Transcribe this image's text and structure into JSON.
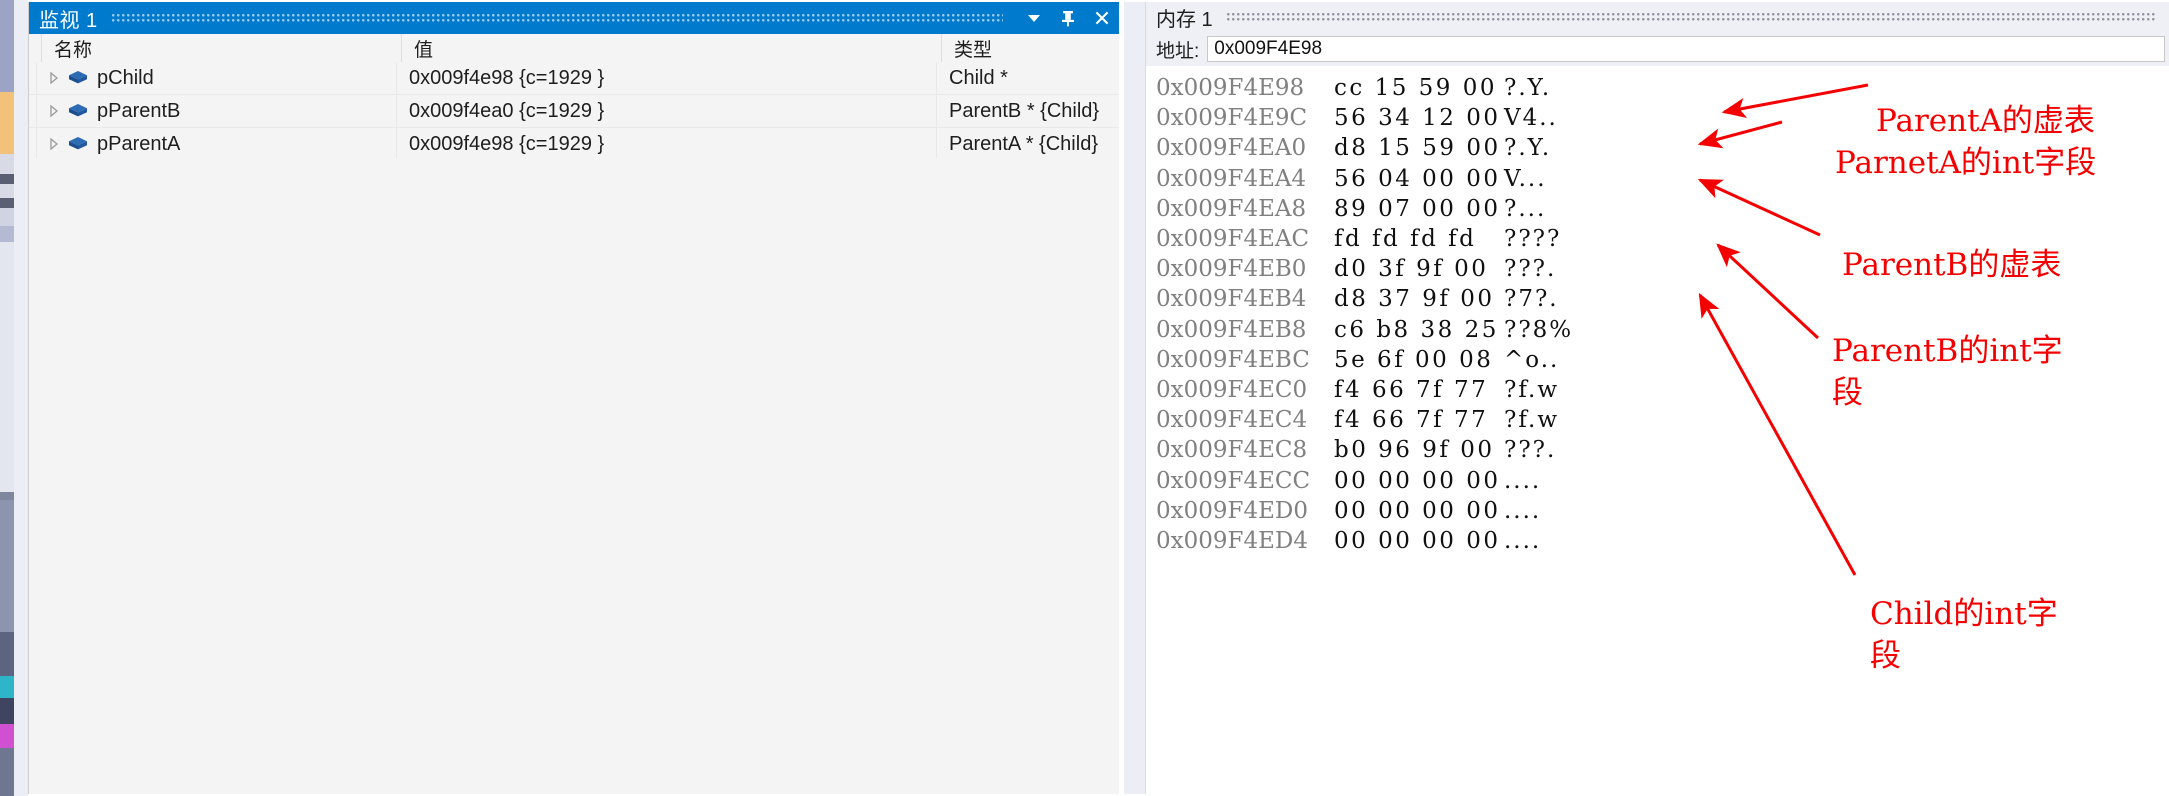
{
  "watch": {
    "title": "监视 1",
    "titlebar_buttons": [
      {
        "name": "dropdown-icon",
        "glyph": "chevron-down"
      },
      {
        "name": "pin-icon",
        "glyph": "pin"
      },
      {
        "name": "close-icon",
        "glyph": "close"
      }
    ],
    "columns": [
      "名称",
      "值",
      "类型"
    ],
    "rows": [
      {
        "name": "pChild",
        "value": "0x009f4e98 {c=1929 }",
        "type": "Child *"
      },
      {
        "name": "pParentB",
        "value": "0x009f4ea0 {c=1929 }",
        "type": "ParentB * {Child}"
      },
      {
        "name": "pParentA",
        "value": "0x009f4e98 {c=1929 }",
        "type": "ParentA * {Child}"
      }
    ]
  },
  "memory": {
    "title": "内存 1",
    "address_label": "地址:",
    "address_value": "0x009F4E98",
    "rows": [
      {
        "address": "0x009F4E98",
        "bytes": "cc 15 59 00",
        "ascii": "?.Y."
      },
      {
        "address": "0x009F4E9C",
        "bytes": "56 34 12 00",
        "ascii": "V4.."
      },
      {
        "address": "0x009F4EA0",
        "bytes": "d8 15 59 00",
        "ascii": "?.Y."
      },
      {
        "address": "0x009F4EA4",
        "bytes": "56 04 00 00",
        "ascii": "V..."
      },
      {
        "address": "0x009F4EA8",
        "bytes": "89 07 00 00",
        "ascii": "?..."
      },
      {
        "address": "0x009F4EAC",
        "bytes": "fd fd fd fd",
        "ascii": "????"
      },
      {
        "address": "0x009F4EB0",
        "bytes": "d0 3f 9f 00",
        "ascii": "???."
      },
      {
        "address": "0x009F4EB4",
        "bytes": "d8 37 9f 00",
        "ascii": "?7?."
      },
      {
        "address": "0x009F4EB8",
        "bytes": "c6 b8 38 25",
        "ascii": "??8%"
      },
      {
        "address": "0x009F4EBC",
        "bytes": "5e 6f 00 08",
        "ascii": "^o.."
      },
      {
        "address": "0x009F4EC0",
        "bytes": "f4 66 7f 77",
        "ascii": "?f.w"
      },
      {
        "address": "0x009F4EC4",
        "bytes": "f4 66 7f 77",
        "ascii": "?f.w"
      },
      {
        "address": "0x009F4EC8",
        "bytes": "b0 96 9f 00",
        "ascii": "???."
      },
      {
        "address": "0x009F4ECC",
        "bytes": "00 00 00 00",
        "ascii": "...."
      },
      {
        "address": "0x009F4ED0",
        "bytes": "00 00 00 00",
        "ascii": "...."
      },
      {
        "address": "0x009F4ED4",
        "bytes": "00 00 00 00",
        "ascii": "...."
      }
    ]
  },
  "annotations": {
    "color": "#f50000",
    "labels": [
      "ParentA的虚表",
      "ParnetA的int字段",
      "ParentB的虚表",
      "ParentB的int字\n段",
      "Child的int字\n段"
    ]
  }
}
